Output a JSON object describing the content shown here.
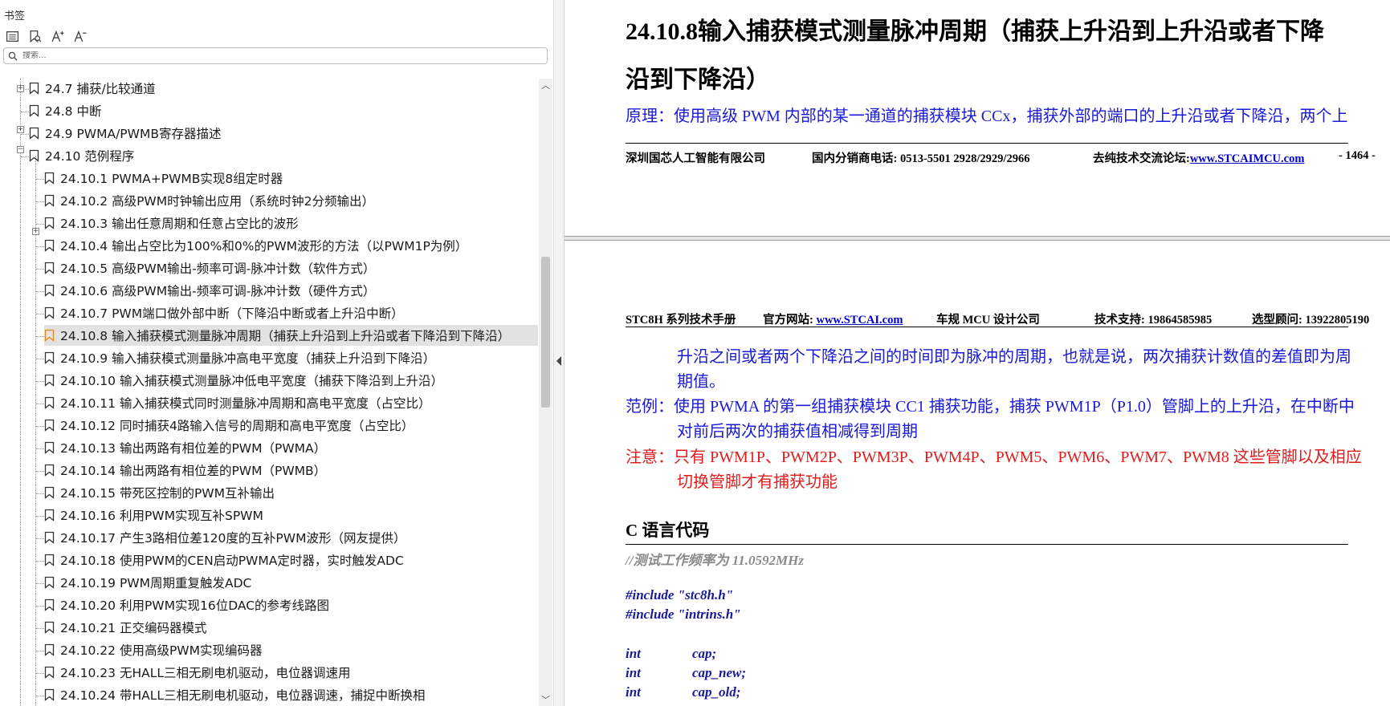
{
  "sidebar": {
    "title": "书签",
    "search_placeholder": "搜索...",
    "items": [
      {
        "label": "24.7 捕获/比较通道"
      },
      {
        "label": "24.8 中断"
      },
      {
        "label": "24.9  PWMA/PWMB寄存器描述"
      },
      {
        "label": "24.10  范例程序"
      },
      {
        "label": "24.10.1 PWMA+PWMB实现8组定时器"
      },
      {
        "label": "24.10.2 高级PWM时钟输出应用（系统时钟2分频输出）"
      },
      {
        "label": "24.10.3 输出任意周期和任意占空比的波形"
      },
      {
        "label": "24.10.4 输出占空比为100%和0%的PWM波形的方法（以PWM1P为例）"
      },
      {
        "label": "24.10.5 高级PWM输出-频率可调-脉冲计数（软件方式）"
      },
      {
        "label": "24.10.6 高级PWM输出-频率可调-脉冲计数（硬件方式）"
      },
      {
        "label": "24.10.7 PWM端口做外部中断（下降沿中断或者上升沿中断）"
      },
      {
        "label": "24.10.8 输入捕获模式测量脉冲周期（捕获上升沿到上升沿或者下降沿到下降沿）"
      },
      {
        "label": "24.10.9 输入捕获模式测量脉冲高电平宽度（捕获上升沿到下降沿）"
      },
      {
        "label": "24.10.10 输入捕获模式测量脉冲低电平宽度（捕获下降沿到上升沿）"
      },
      {
        "label": "24.10.11 输入捕获模式同时测量脉冲周期和高电平宽度（占空比）"
      },
      {
        "label": "24.10.12 同时捕获4路输入信号的周期和高电平宽度（占空比）"
      },
      {
        "label": "24.10.13 输出两路有相位差的PWM（PWMA）"
      },
      {
        "label": "24.10.14 输出两路有相位差的PWM（PWMB）"
      },
      {
        "label": "24.10.15 带死区控制的PWM互补输出"
      },
      {
        "label": "24.10.16 利用PWM实现互补SPWM"
      },
      {
        "label": "24.10.17 产生3路相位差120度的互补PWM波形（网友提供）"
      },
      {
        "label": "24.10.18 使用PWM的CEN启动PWMA定时器，实时触发ADC"
      },
      {
        "label": "24.10.19 PWM周期重复触发ADC"
      },
      {
        "label": "24.10.20 利用PWM实现16位DAC的参考线路图"
      },
      {
        "label": "24.10.21 正交编码器模式"
      },
      {
        "label": "24.10.22 使用高级PWM实现编码器"
      },
      {
        "label": "24.10.23 无HALL三相无刷电机驱动，电位器调速用"
      },
      {
        "label": "24.10.24 带HALL三相无刷电机驱动，电位器调速，捕捉中断换相"
      }
    ]
  },
  "doc": {
    "page1": {
      "title_line1": "24.10.8输入捕获模式测量脉冲周期（捕获上升沿到上升沿或者下降",
      "title_line2": "沿到下降沿）",
      "principle": "原理：使用高级 PWM 内部的某一通道的捕获模块 CCx，捕获外部的端口的上升沿或者下降沿，两个上",
      "footer_company": "深圳国芯人工智能有限公司",
      "footer_phone": "国内分销商电话: 0513-5501 2928/2929/2966",
      "footer_forum_label": "去纯技术交流论坛:",
      "footer_forum_link": "www.STCAIMCU.com",
      "footer_page": "- 1464 -"
    },
    "page2": {
      "header_manual": "STC8H 系列技术手册",
      "header_site_label": "官方网站: ",
      "header_site_link": "www.STCAI.com",
      "header_design": "车规 MCU 设计公司",
      "header_support": "技术支持: 19864585985",
      "header_advisor": "选型顾问: 13922805190",
      "cont_line1": "升沿之间或者两个下降沿之间的时间即为脉冲的周期，也就是说，两次捕获计数值的差值即为周",
      "cont_line2": "期值。",
      "example_line1": "范例：使用 PWMA 的第一组捕获模块 CC1 捕获功能，捕获 PWM1P（P1.0）管脚上的上升沿，在中断中",
      "example_line2": "对前后两次的捕获值相减得到周期",
      "note_line1": "注意：只有 PWM1P、PWM2P、PWM3P、PWM4P、PWM5、PWM6、PWM7、PWM8 这些管脚以及相应",
      "note_line2": "切换管脚才有捕获功能",
      "code_heading": "C 语言代码",
      "code_comment": "//测试工作频率为 11.0592MHz",
      "include1": "#include \"stc8h.h\"",
      "include2": "#include \"intrins.h\"",
      "decls": [
        {
          "type": "int",
          "name": "cap;"
        },
        {
          "type": "int",
          "name": "cap_new;"
        },
        {
          "type": "int",
          "name": "cap_old;"
        }
      ]
    }
  }
}
